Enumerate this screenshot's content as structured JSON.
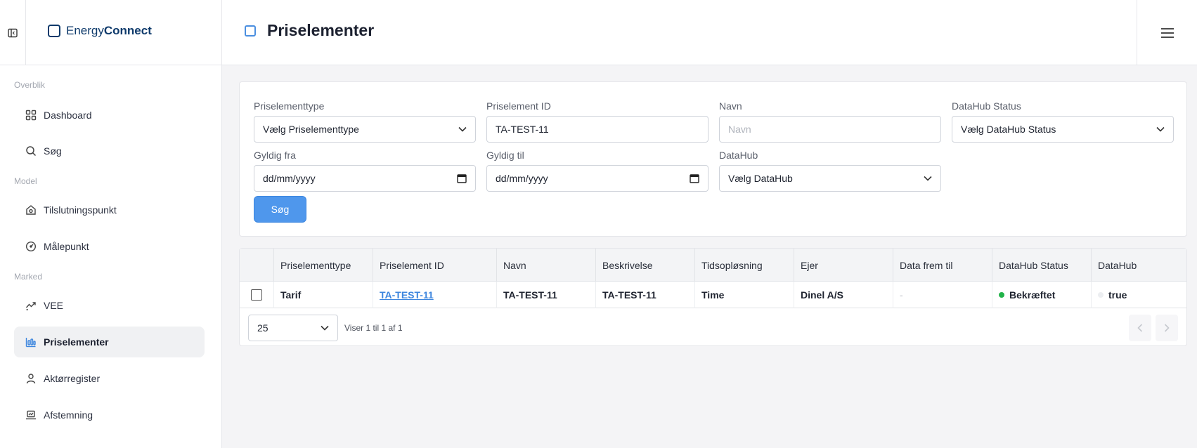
{
  "app": {
    "brand_part1": "Energy",
    "brand_part2": "Connect"
  },
  "sidebar": {
    "sections": [
      {
        "label": "Overblik"
      },
      {
        "label": "Model"
      },
      {
        "label": "Marked"
      }
    ],
    "items": [
      {
        "label": "Dashboard",
        "icon": "grid-icon"
      },
      {
        "label": "Søg",
        "icon": "search-icon"
      },
      {
        "label": "Tilslutningspunkt",
        "icon": "house-icon"
      },
      {
        "label": "Målepunkt",
        "icon": "gauge-icon"
      },
      {
        "label": "VEE",
        "icon": "trend-icon"
      },
      {
        "label": "Priselementer",
        "icon": "price-chart-icon",
        "active": true
      },
      {
        "label": "Aktørregister",
        "icon": "user-icon"
      },
      {
        "label": "Afstemning",
        "icon": "laptop-icon"
      }
    ]
  },
  "header": {
    "title": "Priselementer"
  },
  "filters": {
    "type": {
      "label": "Priselementtype",
      "value": "Vælg Priselementtype"
    },
    "id": {
      "label": "Priselement ID",
      "value": "TA-TEST-11"
    },
    "name": {
      "label": "Navn",
      "placeholder": "Navn"
    },
    "status": {
      "label": "DataHub Status",
      "value": "Vælg DataHub Status"
    },
    "valid_from": {
      "label": "Gyldig fra",
      "value": "dd/mm/yyyy"
    },
    "valid_to": {
      "label": "Gyldig til",
      "value": "dd/mm/yyyy"
    },
    "datahub": {
      "label": "DataHub",
      "value": "Vælg DataHub"
    },
    "search_button": "Søg"
  },
  "table": {
    "columns": [
      "Priselementtype",
      "Priselement ID",
      "Navn",
      "Beskrivelse",
      "Tidsopløsning",
      "Ejer",
      "Data frem til",
      "DataHub Status",
      "DataHub"
    ],
    "rows": [
      {
        "type": "Tarif",
        "id": "TA-TEST-11",
        "name": "TA-TEST-11",
        "description": "TA-TEST-11",
        "resolution": "Time",
        "owner": "Dinel A/S",
        "data_until": "-",
        "status": "Bekræftet",
        "status_color": "#22b34a",
        "datahub": "true",
        "datahub_color": "#eceef1"
      }
    ]
  },
  "pagination": {
    "page_size": "25",
    "info": "Viser 1 til 1 af 1"
  },
  "colors": {
    "accent": "#4f97ec",
    "brand": "#0e3a6b"
  }
}
